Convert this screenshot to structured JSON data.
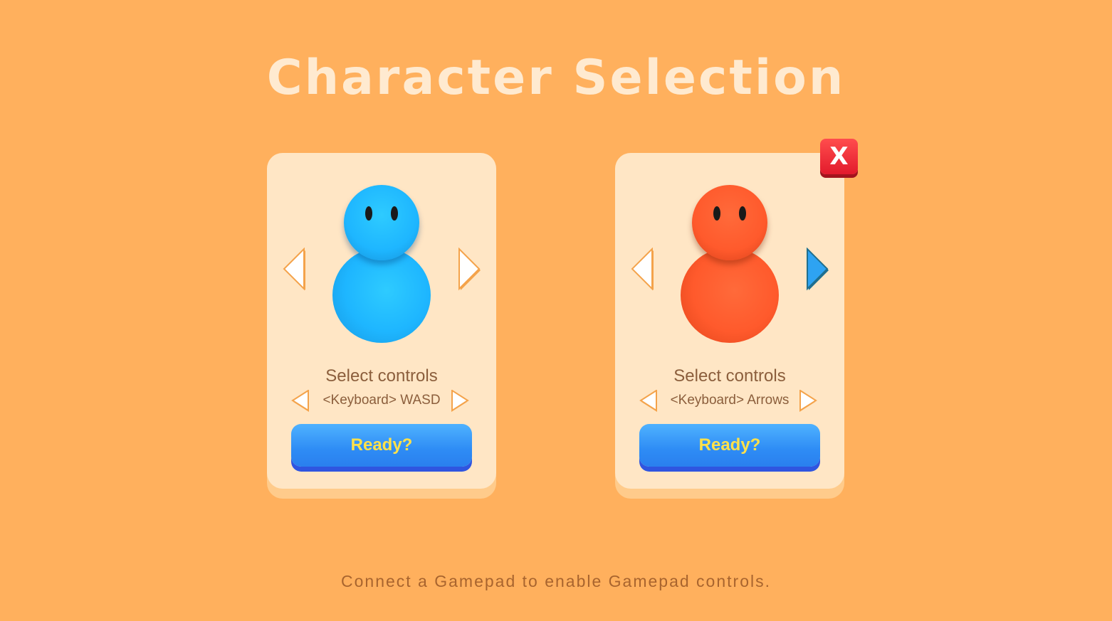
{
  "screen": {
    "title": "Character Selection",
    "footer_hint": "Connect a Gamepad to enable Gamepad controls.",
    "close_button_label": "X"
  },
  "players": [
    {
      "character_color": "#1EB6FF",
      "character_dark": "#1797E0",
      "controls_label": "Select controls",
      "controls_value": "<Keyboard> WASD",
      "ready_label": "Ready?",
      "right_arrow_highlighted": false
    },
    {
      "character_color": "#FF5A2C",
      "character_dark": "#E0441A",
      "controls_label": "Select controls",
      "controls_value": "<Keyboard> Arrows",
      "ready_label": "Ready?",
      "right_arrow_highlighted": true
    }
  ],
  "colors": {
    "background": "#FFB05D",
    "card": "#FFE6C5",
    "arrow_fill": "#FFFFFF",
    "arrow_outline": "#F4A34B",
    "arrow_highlight": "#2EA3F2",
    "ready_text": "#FFE14A",
    "close": "#E21B2C"
  }
}
